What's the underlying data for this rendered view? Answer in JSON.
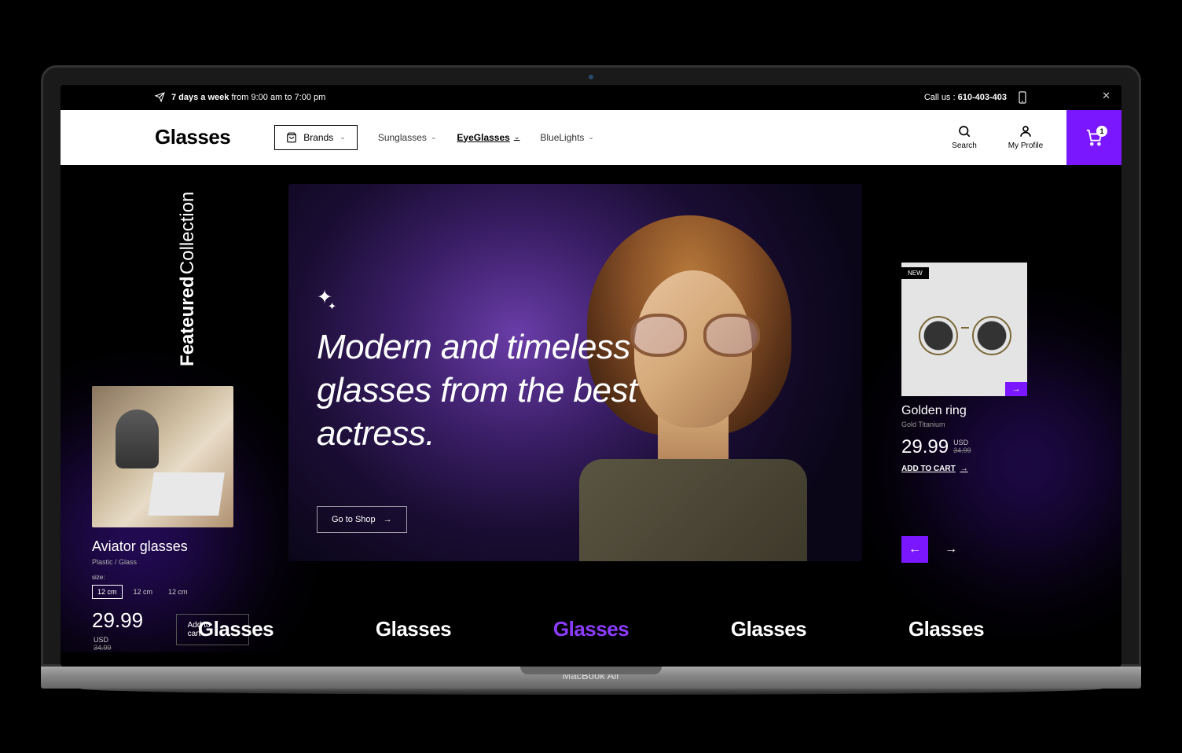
{
  "topbar": {
    "hours_bold": "7 days a week",
    "hours_rest": " from 9:00 am to 7:00 pm",
    "callus_label": "Call us : ",
    "phone": "610-403-403"
  },
  "header": {
    "logo": "Glasses",
    "brands_label": "Brands",
    "nav": [
      {
        "label": "Sunglasses"
      },
      {
        "label": "EyeGlasses"
      },
      {
        "label": "BlueLights"
      }
    ],
    "search_label": "Search",
    "profile_label": "My Profile",
    "cart_count": "1"
  },
  "featured": {
    "line1": "Feateured",
    "line2": "Collection"
  },
  "left_product": {
    "title": "Aviator glasses",
    "subtitle": "Plastic / Glass",
    "size_label": "size:",
    "sizes": [
      "12 cm",
      "12 cm",
      "12 cm"
    ],
    "price": "29.99",
    "currency": "USD",
    "old_price": "34.99",
    "add_label": "Add to cart"
  },
  "hero": {
    "headline": "Modern and timeless glasses from the best actress.",
    "cta": "Go to Shop"
  },
  "right_product": {
    "tag": "NEW",
    "title": "Golden ring",
    "subtitle": "Gold Titanium",
    "price": "29.99",
    "currency": "USD",
    "old_price": "34.99",
    "add_label": "ADD TO CART"
  },
  "brand_strip": [
    "Glasses",
    "Glasses",
    "Glasses",
    "Glasses",
    "Glasses"
  ],
  "device_label": "MacBook Air"
}
